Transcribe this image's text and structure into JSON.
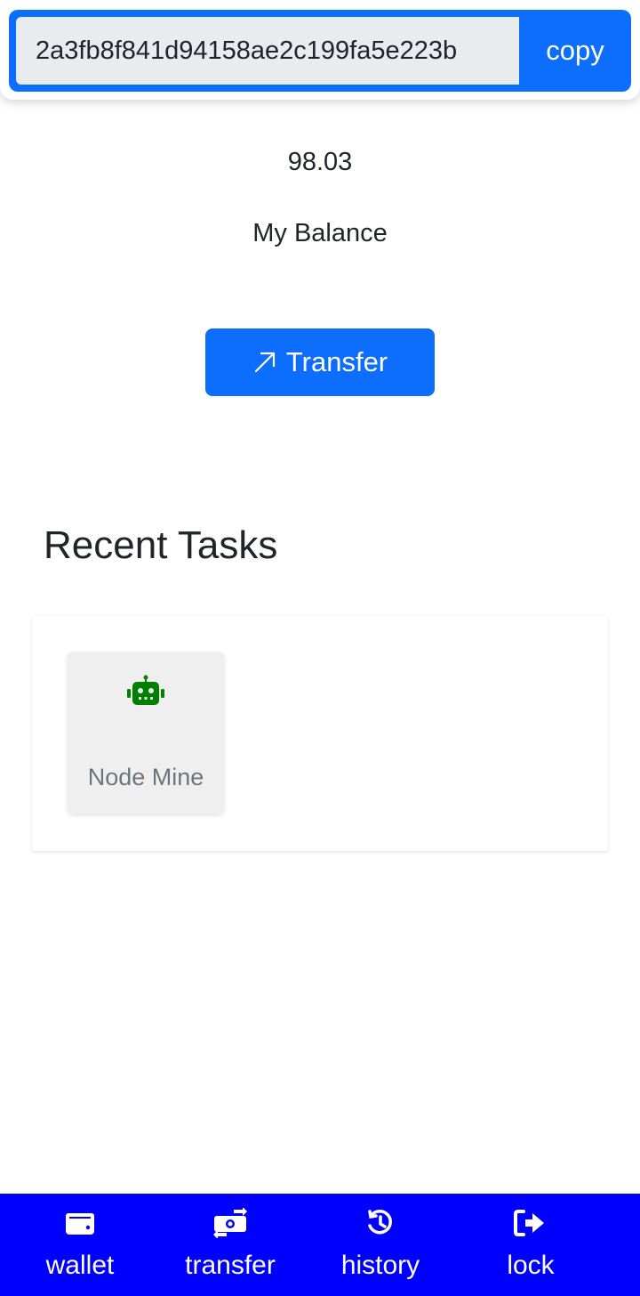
{
  "address_bar": {
    "address_value": "2a3fb8f841d94158ae2c199fa5e223b",
    "copy_label": "copy"
  },
  "balance": {
    "amount": "98.03",
    "label": "My Balance"
  },
  "transfer_button": {
    "label": "Transfer",
    "icon": "arrow-up-right-icon"
  },
  "recent_tasks": {
    "title": "Recent Tasks",
    "items": [
      {
        "label": "Node Mine",
        "icon": "robot-icon",
        "icon_color": "#008000"
      }
    ]
  },
  "bottom_nav": {
    "items": [
      {
        "label": "wallet",
        "icon": "wallet-icon"
      },
      {
        "label": "transfer",
        "icon": "money-transfer-icon"
      },
      {
        "label": "history",
        "icon": "history-icon"
      },
      {
        "label": "lock",
        "icon": "sign-out-icon"
      }
    ]
  },
  "colors": {
    "primary": "#0d6efd",
    "nav_background": "#0000ff",
    "task_icon": "#008000"
  }
}
